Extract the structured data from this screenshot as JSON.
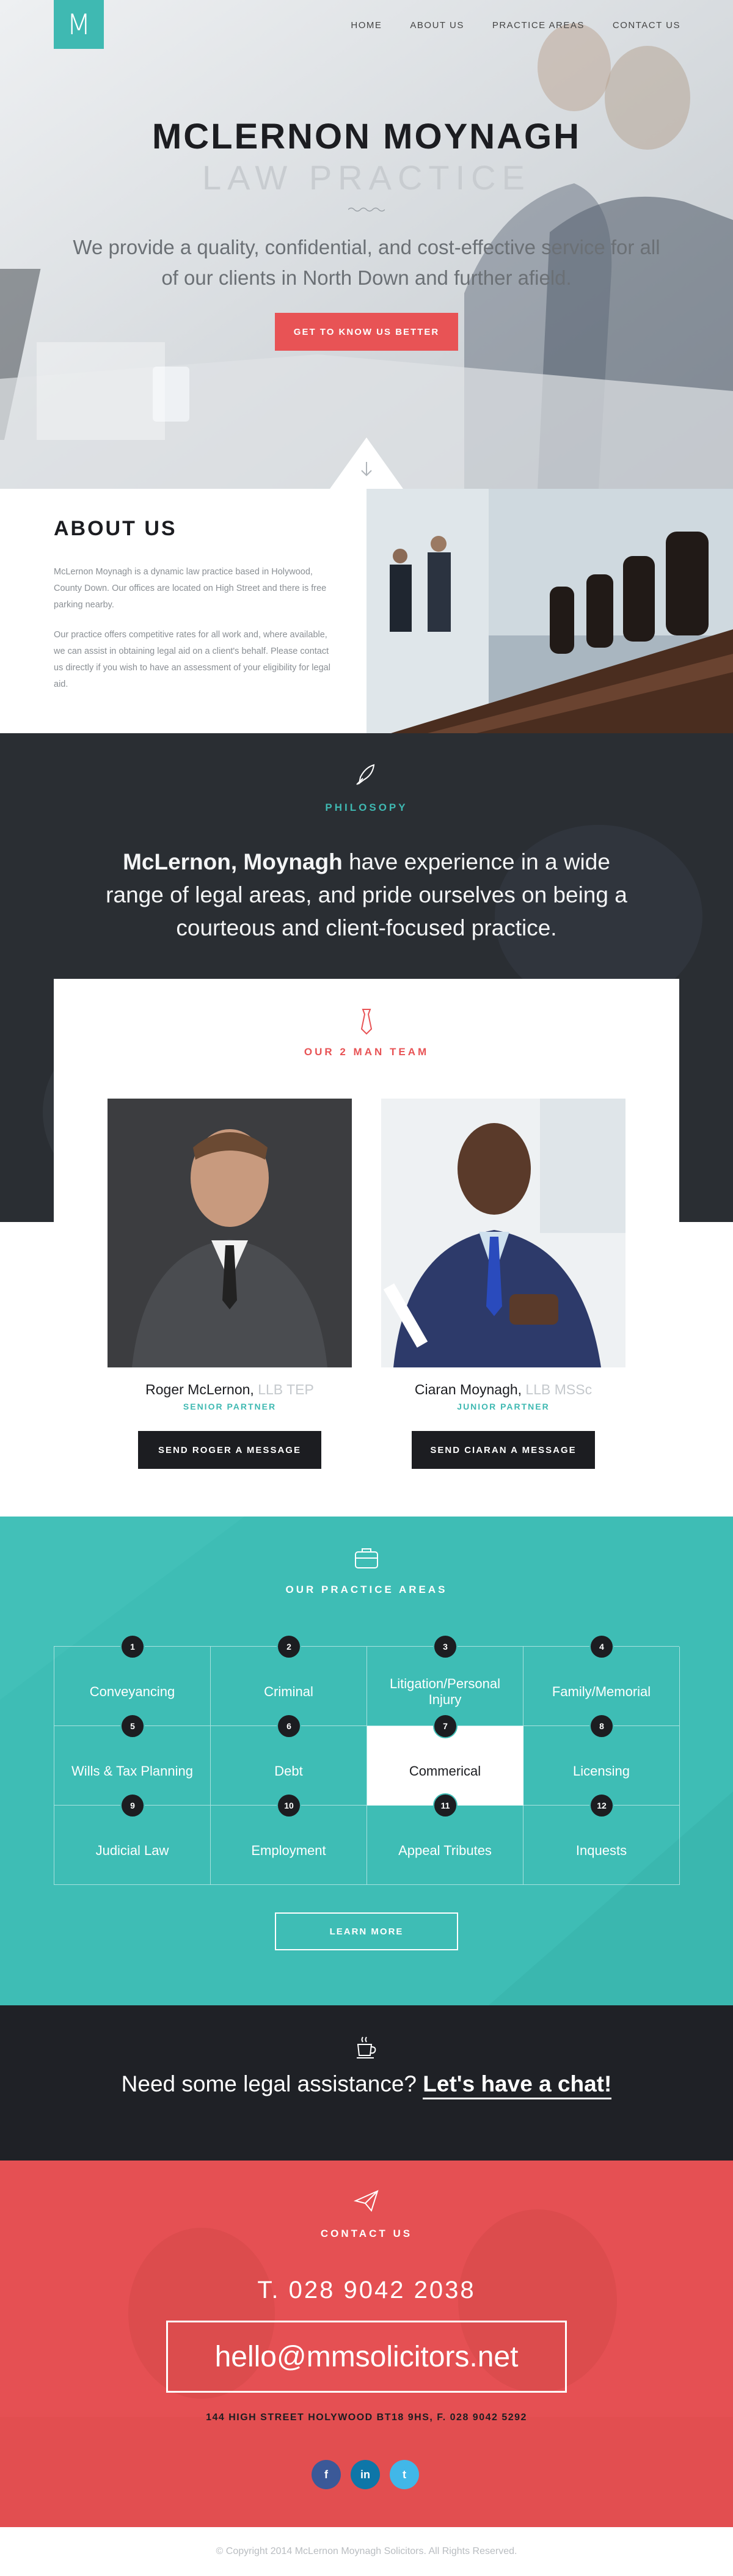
{
  "nav": {
    "logo_letter": "M",
    "items": [
      "HOME",
      "ABOUT US",
      "PRACTICE AREAS",
      "CONTACT US"
    ]
  },
  "hero": {
    "title": "MCLERNON MOYNAGH",
    "subtitle": "LAW PRACTICE",
    "description": "We provide a quality, confidential, and cost-effective service for all of our clients in North Down and further afield.",
    "cta": "GET TO KNOW US BETTER"
  },
  "about": {
    "heading": "ABOUT US",
    "para1": "McLernon Moynagh is a dynamic law practice based in Holywood, County Down. Our offices are located on High Street and there is free parking nearby.",
    "para2": "Our practice offers competitive rates for all work and, where available, we can assist in obtaining legal aid on a client's behalf. Please contact us directly if you wish to have an assessment of your eligibility for legal aid."
  },
  "philosophy": {
    "label": "PHILOSOPY",
    "bold": "McLernon, Moynagh",
    "text": " have experience in a wide range of legal areas, and pride ourselves on being a courteous and client-focused practice."
  },
  "team": {
    "label": "OUR 2 MAN TEAM",
    "members": [
      {
        "name": "Roger McLernon,",
        "quals": " LLB TEP",
        "role": "SENIOR PARTNER",
        "button": "SEND ROGER A MESSAGE"
      },
      {
        "name": "Ciaran Moynagh,",
        "quals": " LLB MSSc",
        "role": "JUNIOR PARTNER",
        "button": "SEND CIARAN A MESSAGE"
      }
    ]
  },
  "practice_areas": {
    "label": "OUR PRACTICE AREAS",
    "items": [
      {
        "num": "1",
        "label": "Conveyancing"
      },
      {
        "num": "2",
        "label": "Criminal"
      },
      {
        "num": "3",
        "label": "Litigation/Personal Injury"
      },
      {
        "num": "4",
        "label": "Family/Memorial"
      },
      {
        "num": "5",
        "label": "Wills & Tax Planning"
      },
      {
        "num": "6",
        "label": "Debt"
      },
      {
        "num": "7",
        "label": "Commerical"
      },
      {
        "num": "8",
        "label": "Licensing"
      },
      {
        "num": "9",
        "label": "Judicial Law"
      },
      {
        "num": "10",
        "label": "Employment"
      },
      {
        "num": "11",
        "label": "Appeal Tributes"
      },
      {
        "num": "12",
        "label": "Inquests"
      }
    ],
    "button": "LEARN MORE"
  },
  "chat": {
    "text": "Need some legal assistance? ",
    "link": "Let's have a chat!"
  },
  "contact": {
    "label": "CONTACT US",
    "phone": "T. 028 9042 2038",
    "email": "hello@mmsolicitors.net",
    "address": "144 HIGH STREET HOLYWOOD BT18 9HS, F. 028 9042 5292",
    "socials": [
      "f",
      "in",
      "t"
    ]
  },
  "footer": {
    "copyright": "© Copyright 2014 McLernon Moynagh Solicitors. All Rights Reserved."
  },
  "colors": {
    "teal": "#3fb9b2",
    "red": "#e85355",
    "dark": "#1c1d21"
  }
}
